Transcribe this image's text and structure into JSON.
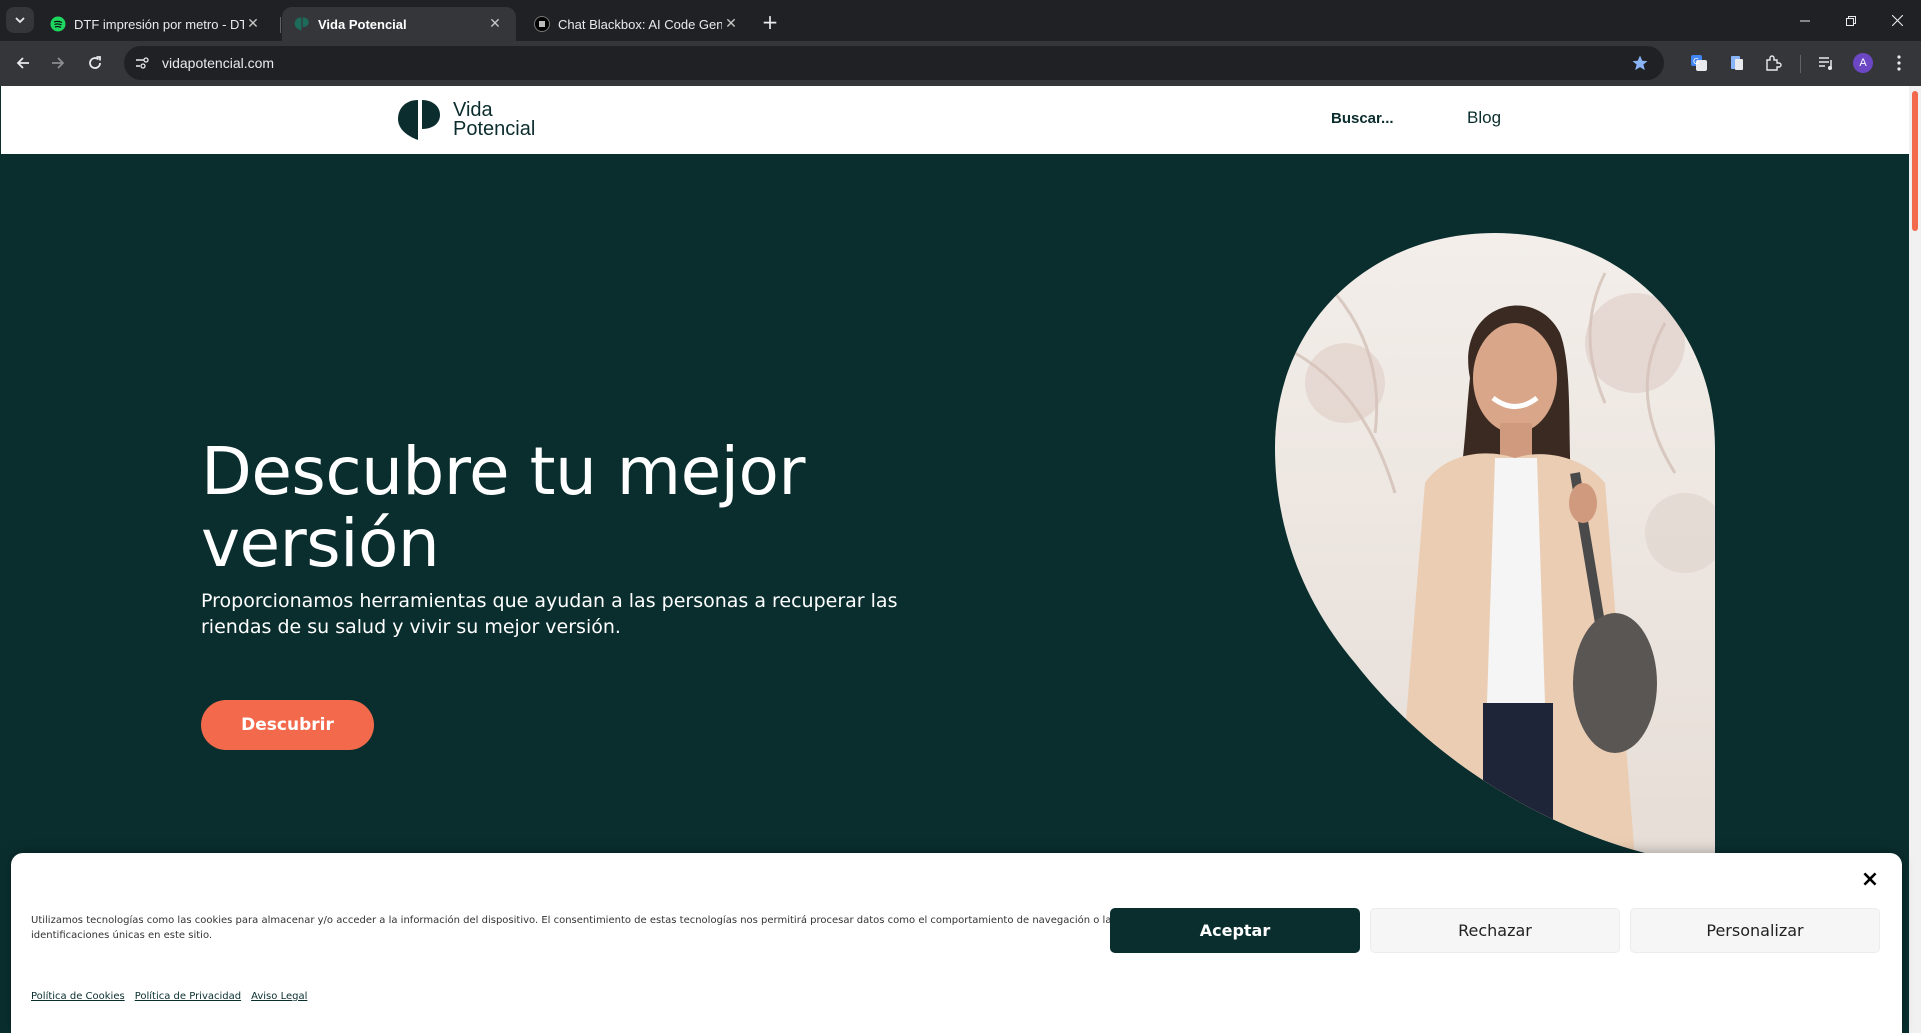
{
  "browser": {
    "tabs": [
      {
        "title": "DTF impresión por metro - DTF",
        "favicon": "spotify-like-green-icon",
        "active": false
      },
      {
        "title": "Vida Potencial",
        "favicon": "vida-potencial-logo-icon",
        "active": true
      },
      {
        "title": "Chat Blackbox: AI Code Generat",
        "favicon": "blackbox-icon",
        "active": false
      }
    ],
    "new_tab": "+",
    "url": "vidapotencial.com",
    "profile_initial": "A",
    "colors": {
      "accent_star": "#8ab4f8",
      "profile": "#6c47c4"
    }
  },
  "site": {
    "logo": {
      "line1": "Vida",
      "line2": "Potencial"
    },
    "nav": {
      "search": "Buscar...",
      "blog": "Blog"
    },
    "hero": {
      "title": "Descubre tu mejor versión",
      "subtitle": "Proporcionamos herramientas que ayudan a las personas a recuperar las riendas de su salud y vivir su mejor versión.",
      "cta": "Descubrir"
    },
    "colors": {
      "primary": "#0a2e2e",
      "accent": "#f26a4b"
    }
  },
  "cookie_banner": {
    "text": "Utilizamos tecnologías como las cookies para almacenar y/o acceder a la información del dispositivo. El consentimiento de estas tecnologías nos permitirá procesar datos como el comportamiento de navegación o las identificaciones únicas en este sitio.",
    "accept": "Aceptar",
    "reject": "Rechazar",
    "customize": "Personalizar",
    "close": "×",
    "links": [
      "Política de Cookies",
      "Política de Privacidad",
      "Aviso Legal"
    ]
  }
}
